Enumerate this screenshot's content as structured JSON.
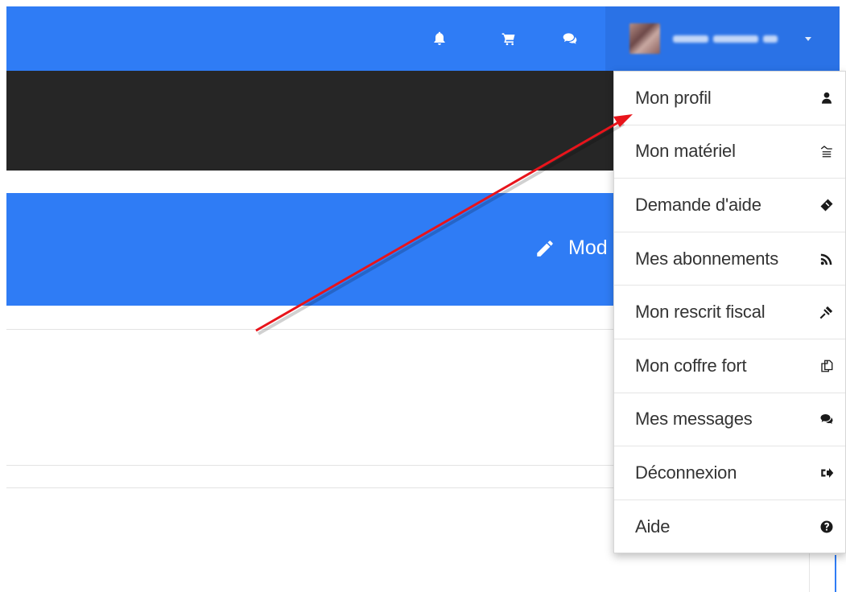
{
  "header": {
    "notification_icon": "bell-icon",
    "cart_icon": "cart-icon",
    "chat_icon": "comments-icon",
    "user_name_blurred": "",
    "accent_color": "#2f7cf5"
  },
  "banner": {
    "edit_label": "Mod"
  },
  "user_menu": {
    "items": [
      {
        "label": "Mon profil",
        "icon": "user-icon"
      },
      {
        "label": "Mon matériel",
        "icon": "equipment-icon"
      },
      {
        "label": "Demande d'aide",
        "icon": "help-request-icon"
      },
      {
        "label": "Mes abonnements",
        "icon": "rss-icon"
      },
      {
        "label": "Mon rescrit fiscal",
        "icon": "gavel-icon"
      },
      {
        "label": "Mon coffre fort",
        "icon": "copy-icon"
      },
      {
        "label": "Mes messages",
        "icon": "comments-icon"
      },
      {
        "label": "Déconnexion",
        "icon": "sign-out-icon"
      },
      {
        "label": "Aide",
        "icon": "question-circle-icon"
      }
    ]
  },
  "annotation": {
    "arrow_color": "#e8141b"
  }
}
